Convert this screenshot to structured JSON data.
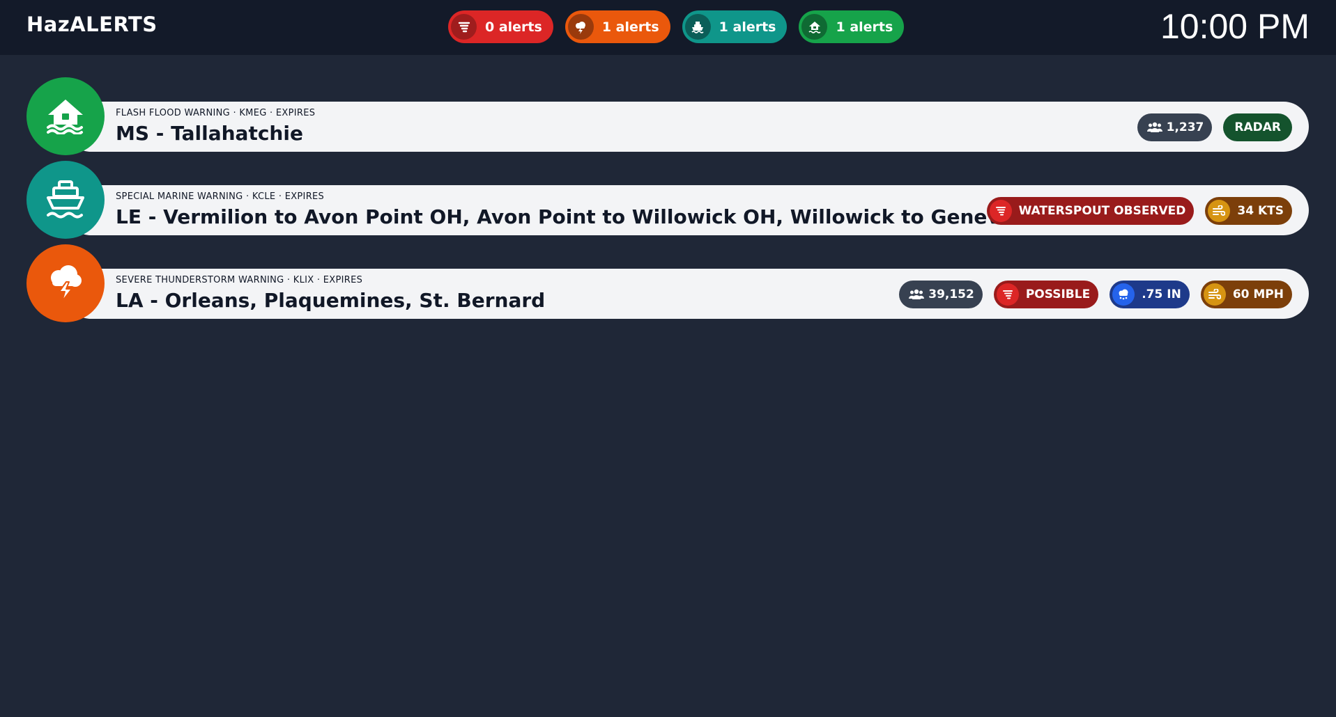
{
  "header": {
    "brand": "HazALERTS",
    "clock": "10:00 PM",
    "counters": [
      {
        "icon": "tornado-icon",
        "label": "0 alerts",
        "color": "#dc2626"
      },
      {
        "icon": "thunderstorm-icon",
        "label": "1 alerts",
        "color": "#ea580c"
      },
      {
        "icon": "ship-icon",
        "label": "1 alerts",
        "color": "#0f968a"
      },
      {
        "icon": "flood-house-icon",
        "label": "1 alerts",
        "color": "#16a34a"
      }
    ]
  },
  "alerts": [
    {
      "icon": "flood-house-icon",
      "color": "#16a34a",
      "meta": "FLASH FLOOD WARNING · KMEG · EXPIRES",
      "area": "MS - Tallahatchie",
      "population": "1,237",
      "radar": "RADAR"
    },
    {
      "icon": "ship-icon",
      "color": "#0f968a",
      "meta": "SPECIAL MARINE WARNING · KCLE · EXPIRES",
      "area": "LE - Vermilion to Avon Point OH, Avon Point to Willowick OH, Willowick to Geneva-on-the-Lake OH",
      "tornado": "WATERSPOUT OBSERVED",
      "wind": "34 KTS"
    },
    {
      "icon": "thunderstorm-icon",
      "color": "#ea580c",
      "meta": "SEVERE THUNDERSTORM WARNING · KLIX · EXPIRES",
      "area": "LA - Orleans, Plaquemines, St. Bernard",
      "population": "39,152",
      "tornado": "POSSIBLE",
      "hail": ".75 IN",
      "wind": "60 MPH"
    }
  ]
}
